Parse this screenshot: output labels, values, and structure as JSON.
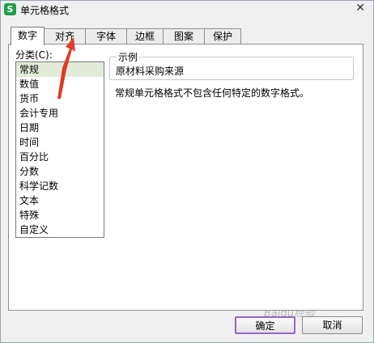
{
  "window": {
    "title": "单元格格式",
    "app_icon": "S",
    "close_glyph": "✕"
  },
  "tabs": [
    {
      "label": "数字",
      "active": true
    },
    {
      "label": "对齐"
    },
    {
      "label": "字体"
    },
    {
      "label": "边框"
    },
    {
      "label": "图案"
    },
    {
      "label": "保护"
    }
  ],
  "category": {
    "label": "分类(C):",
    "items": [
      "常规",
      "数值",
      "货币",
      "会计专用",
      "日期",
      "时间",
      "百分比",
      "分数",
      "科学记数",
      "文本",
      "特殊",
      "自定义"
    ],
    "selected": "常规"
  },
  "sample": {
    "legend": "示例",
    "value": "原材料采购来源"
  },
  "description": "常规单元格格式不包含任何特定的数字格式。",
  "buttons": {
    "ok": "确定",
    "cancel": "取消"
  },
  "watermark": "Baidu经验",
  "colors": {
    "arrow": "#e23a2a",
    "selected_bg": "#e2ecd9",
    "ok_border": "#9a63c9",
    "app_icon": "#1f9e45"
  }
}
